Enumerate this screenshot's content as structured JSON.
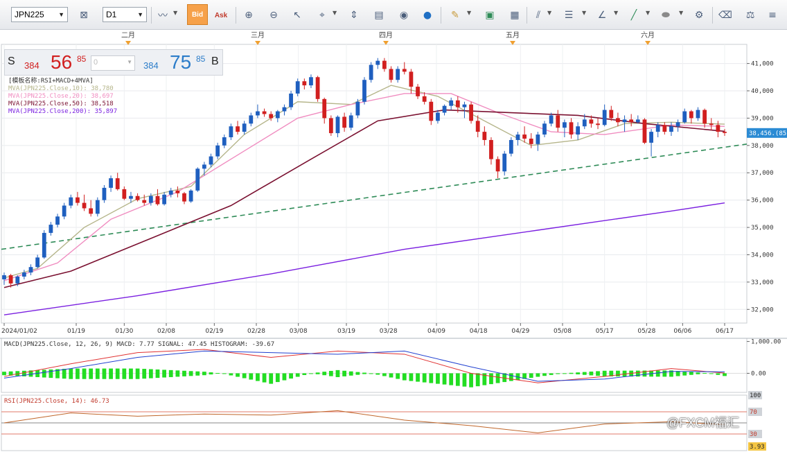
{
  "toolbar": {
    "symbol": "JPN225",
    "timeframe": "D1",
    "bid_label": "Bid",
    "ask_label": "Ask"
  },
  "quote": {
    "sell_label": "S",
    "sell_prefix": "384",
    "sell_big": "56",
    "sell_sup": "85",
    "lot_value": "0",
    "buy_prefix": "384",
    "buy_big": "75",
    "buy_sup": "85",
    "buy_label": "B"
  },
  "colors": {
    "up": "#1f5fbf",
    "down": "#d11f1f",
    "mva10": "#b5b58a",
    "mva20": "#f08cc0",
    "mva50": "#7a1030",
    "mva200": "#7a1fe0",
    "trend": "#2e8b57",
    "macd": "#e03030",
    "signal": "#2040d0",
    "hist": "#22dd22"
  },
  "indicator_legend": {
    "title": "[模板名称:RSI+MACD+4MVA]",
    "mva10": "MVA(JPN225.Close,10): 38,780",
    "mva20": "MVA(JPN225.Close,20): 38,697",
    "mva50": "MVA(JPN225.Close,50): 38,518",
    "mva200": "MVA(JPN225.Close,200): 35,897"
  },
  "months": [
    "二月",
    "三月",
    "四月",
    "五月",
    "六月"
  ],
  "x_labels": [
    "2024/01/02",
    "01/19",
    "01/30",
    "02/08",
    "02/19",
    "02/28",
    "03/08",
    "03/19",
    "03/28",
    "04/09",
    "04/18",
    "04/29",
    "05/08",
    "05/17",
    "05/28",
    "06/06",
    "06/17"
  ],
  "price_axis": {
    "ticks": [
      "41,000",
      "40,000",
      "39,000",
      "38,000",
      "37,000",
      "36,000",
      "35,000",
      "34,000",
      "33,000",
      "32,000"
    ],
    "current_label": "38,456.(85"
  },
  "macd_panel": {
    "legend": "MACD(JPN225.Close, 12, 26, 9)  MACD: 7.77  SIGNAL: 47.45  HISTOGRAM: -39.67",
    "ticks": [
      "1,000.00",
      "0.00"
    ]
  },
  "rsi_panel": {
    "legend": "RSI(JPN225.Close, 14): 46.73",
    "ticks": [
      "100",
      "70",
      "30"
    ],
    "current": "3.93"
  },
  "watermark": "@FXCM福汇",
  "chart_data": {
    "type": "candlestick",
    "series": [
      {
        "name": "JPN225",
        "ohlc": [
          [
            33100,
            33350,
            32900,
            33250
          ],
          [
            33250,
            33300,
            32800,
            32950
          ],
          [
            32950,
            33250,
            32850,
            33200
          ],
          [
            33200,
            33450,
            33100,
            33350
          ],
          [
            33350,
            33650,
            33250,
            33550
          ],
          [
            33550,
            34000,
            33500,
            33900
          ],
          [
            33900,
            34900,
            33850,
            34800
          ],
          [
            34800,
            35200,
            34700,
            35100
          ],
          [
            35100,
            35500,
            35000,
            35400
          ],
          [
            35400,
            35900,
            35300,
            35800
          ],
          [
            35800,
            36200,
            35700,
            36100
          ],
          [
            36100,
            36300,
            35800,
            35900
          ],
          [
            35900,
            36200,
            35600,
            35700
          ],
          [
            35700,
            36000,
            35400,
            35500
          ],
          [
            35500,
            36100,
            35400,
            36000
          ],
          [
            36000,
            36550,
            35900,
            36450
          ],
          [
            36450,
            36900,
            36300,
            36800
          ],
          [
            36800,
            37000,
            36350,
            36400
          ],
          [
            36400,
            36500,
            36000,
            36050
          ],
          [
            36050,
            36300,
            35900,
            36150
          ],
          [
            36150,
            36250,
            35950,
            36000
          ],
          [
            36000,
            36200,
            35800,
            35900
          ],
          [
            35900,
            36250,
            35800,
            36150
          ],
          [
            36150,
            36400,
            35800,
            35850
          ],
          [
            35850,
            36300,
            35800,
            36200
          ],
          [
            36200,
            36450,
            36100,
            36350
          ],
          [
            36350,
            36500,
            36100,
            36250
          ],
          [
            36250,
            36300,
            35850,
            35950
          ],
          [
            35950,
            36400,
            35900,
            36350
          ],
          [
            36350,
            37200,
            36300,
            37150
          ],
          [
            37150,
            37400,
            36900,
            37300
          ],
          [
            37300,
            37700,
            37200,
            37600
          ],
          [
            37600,
            38100,
            37500,
            38000
          ],
          [
            38000,
            38400,
            37900,
            38300
          ],
          [
            38300,
            38800,
            38200,
            38700
          ],
          [
            38700,
            38900,
            38400,
            38500
          ],
          [
            38500,
            38900,
            38400,
            38800
          ],
          [
            38800,
            39200,
            38700,
            39100
          ],
          [
            39100,
            39500,
            39000,
            39250
          ],
          [
            39250,
            39350,
            39050,
            39150
          ],
          [
            39150,
            39250,
            38900,
            39000
          ],
          [
            39000,
            39300,
            38850,
            39250
          ],
          [
            39250,
            39500,
            39100,
            39400
          ],
          [
            39400,
            40000,
            39300,
            39900
          ],
          [
            39900,
            40450,
            39800,
            40350
          ],
          [
            40350,
            40450,
            40050,
            40200
          ],
          [
            40200,
            40600,
            40100,
            40500
          ],
          [
            40500,
            40550,
            39600,
            39700
          ],
          [
            39700,
            39750,
            38800,
            39000
          ],
          [
            39000,
            39100,
            38350,
            38450
          ],
          [
            38450,
            39100,
            38300,
            39050
          ],
          [
            39050,
            39200,
            38500,
            38650
          ],
          [
            38650,
            39200,
            38550,
            39100
          ],
          [
            39100,
            39700,
            39000,
            39600
          ],
          [
            39600,
            40500,
            39500,
            40400
          ],
          [
            40400,
            41050,
            40300,
            40950
          ],
          [
            40950,
            41200,
            40800,
            41100
          ],
          [
            41100,
            41200,
            40700,
            40800
          ],
          [
            40800,
            40900,
            40300,
            40400
          ],
          [
            40400,
            40900,
            40300,
            40800
          ],
          [
            40800,
            41050,
            40600,
            40700
          ],
          [
            40700,
            40800,
            39900,
            40150
          ],
          [
            40150,
            40250,
            39700,
            39800
          ],
          [
            39800,
            39950,
            39500,
            39600
          ],
          [
            39600,
            39700,
            38750,
            38900
          ],
          [
            38900,
            39300,
            38800,
            39200
          ],
          [
            39200,
            39500,
            39100,
            39450
          ],
          [
            39450,
            39750,
            39300,
            39650
          ],
          [
            39650,
            39800,
            39200,
            39400
          ],
          [
            39400,
            39600,
            39000,
            39500
          ],
          [
            39500,
            39600,
            38800,
            38900
          ],
          [
            38900,
            39100,
            38300,
            38500
          ],
          [
            38500,
            38700,
            38000,
            38200
          ],
          [
            38200,
            38300,
            37300,
            37500
          ],
          [
            37500,
            37600,
            36800,
            37050
          ],
          [
            37050,
            37800,
            36900,
            37700
          ],
          [
            37700,
            38300,
            37600,
            38200
          ],
          [
            38200,
            38500,
            38000,
            38400
          ],
          [
            38400,
            38700,
            38100,
            38250
          ],
          [
            38250,
            38450,
            37900,
            38050
          ],
          [
            38050,
            38500,
            37800,
            38400
          ],
          [
            38400,
            38900,
            38300,
            38800
          ],
          [
            38800,
            39200,
            38700,
            39100
          ],
          [
            39100,
            39300,
            38500,
            38650
          ],
          [
            38650,
            38950,
            38300,
            38850
          ],
          [
            38850,
            39000,
            38250,
            38400
          ],
          [
            38400,
            38850,
            38200,
            38700
          ],
          [
            38700,
            39150,
            38600,
            38950
          ],
          [
            38950,
            39100,
            38650,
            38800
          ],
          [
            38800,
            39000,
            38600,
            38750
          ],
          [
            38750,
            39500,
            38700,
            39300
          ],
          [
            39300,
            39450,
            38900,
            39000
          ],
          [
            39000,
            39200,
            38700,
            38850
          ],
          [
            38850,
            39100,
            38500,
            38950
          ],
          [
            38950,
            39150,
            38700,
            38850
          ],
          [
            38850,
            39100,
            38800,
            38950
          ],
          [
            38950,
            39000,
            38050,
            38100
          ],
          [
            38100,
            38600,
            37600,
            38500
          ],
          [
            38500,
            38850,
            38300,
            38750
          ],
          [
            38750,
            38850,
            38400,
            38500
          ],
          [
            38500,
            38850,
            38350,
            38700
          ],
          [
            38700,
            38950,
            38500,
            38850
          ],
          [
            38850,
            39350,
            38800,
            39250
          ],
          [
            39250,
            39300,
            38800,
            39000
          ],
          [
            39000,
            39400,
            38900,
            39300
          ],
          [
            39300,
            39350,
            38650,
            38800
          ],
          [
            38800,
            39000,
            38550,
            38750
          ],
          [
            38750,
            38900,
            38300,
            38500
          ],
          [
            38500,
            38600,
            38350,
            38457
          ]
        ]
      }
    ],
    "moving_averages": {
      "MVA10": [
        [
          0,
          33150
        ],
        [
          5,
          33500
        ],
        [
          12,
          35000
        ],
        [
          20,
          36050
        ],
        [
          28,
          36500
        ],
        [
          36,
          38400
        ],
        [
          44,
          39600
        ],
        [
          52,
          39500
        ],
        [
          58,
          40200
        ],
        [
          65,
          39800
        ],
        [
          72,
          38900
        ],
        [
          79,
          38000
        ],
        [
          86,
          38200
        ],
        [
          93,
          38800
        ],
        [
          100,
          38850
        ],
        [
          108,
          38780
        ]
      ],
      "MVA20": [
        [
          0,
          33050
        ],
        [
          8,
          33700
        ],
        [
          16,
          35300
        ],
        [
          26,
          36300
        ],
        [
          36,
          37800
        ],
        [
          44,
          39000
        ],
        [
          52,
          39500
        ],
        [
          60,
          39900
        ],
        [
          67,
          39900
        ],
        [
          74,
          39200
        ],
        [
          82,
          38500
        ],
        [
          90,
          38400
        ],
        [
          100,
          38750
        ],
        [
          108,
          38697
        ]
      ],
      "MVA50": [
        [
          0,
          32800
        ],
        [
          10,
          33400
        ],
        [
          22,
          34600
        ],
        [
          34,
          35800
        ],
        [
          46,
          37500
        ],
        [
          56,
          38900
        ],
        [
          66,
          39300
        ],
        [
          76,
          39200
        ],
        [
          86,
          39100
        ],
        [
          96,
          38800
        ],
        [
          108,
          38518
        ]
      ],
      "MVA200": [
        [
          0,
          31800
        ],
        [
          20,
          32500
        ],
        [
          40,
          33300
        ],
        [
          60,
          34200
        ],
        [
          80,
          34900
        ],
        [
          100,
          35600
        ],
        [
          108,
          35897
        ]
      ]
    },
    "trendline": [
      [
        0,
        34200
      ],
      [
        108,
        38050
      ]
    ],
    "macd": [
      [
        0,
        -100
      ],
      [
        10,
        300
      ],
      [
        20,
        650
      ],
      [
        30,
        750
      ],
      [
        40,
        500
      ],
      [
        50,
        700
      ],
      [
        60,
        600
      ],
      [
        70,
        0
      ],
      [
        80,
        -300
      ],
      [
        90,
        -100
      ],
      [
        100,
        150
      ],
      [
        108,
        8
      ]
    ],
    "signal": [
      [
        0,
        -150
      ],
      [
        10,
        150
      ],
      [
        20,
        500
      ],
      [
        30,
        700
      ],
      [
        40,
        650
      ],
      [
        50,
        600
      ],
      [
        60,
        700
      ],
      [
        70,
        200
      ],
      [
        80,
        -250
      ],
      [
        90,
        -180
      ],
      [
        100,
        60
      ],
      [
        108,
        47
      ]
    ],
    "rsi": [
      [
        0,
        50
      ],
      [
        10,
        68
      ],
      [
        20,
        62
      ],
      [
        30,
        66
      ],
      [
        40,
        64
      ],
      [
        50,
        72
      ],
      [
        60,
        55
      ],
      [
        70,
        45
      ],
      [
        80,
        32
      ],
      [
        90,
        48
      ],
      [
        100,
        52
      ],
      [
        108,
        47
      ]
    ],
    "ylim": [
      31500,
      41700
    ],
    "macd_ylim": [
      -600,
      1100
    ],
    "rsi_ylim": [
      0,
      100
    ]
  }
}
